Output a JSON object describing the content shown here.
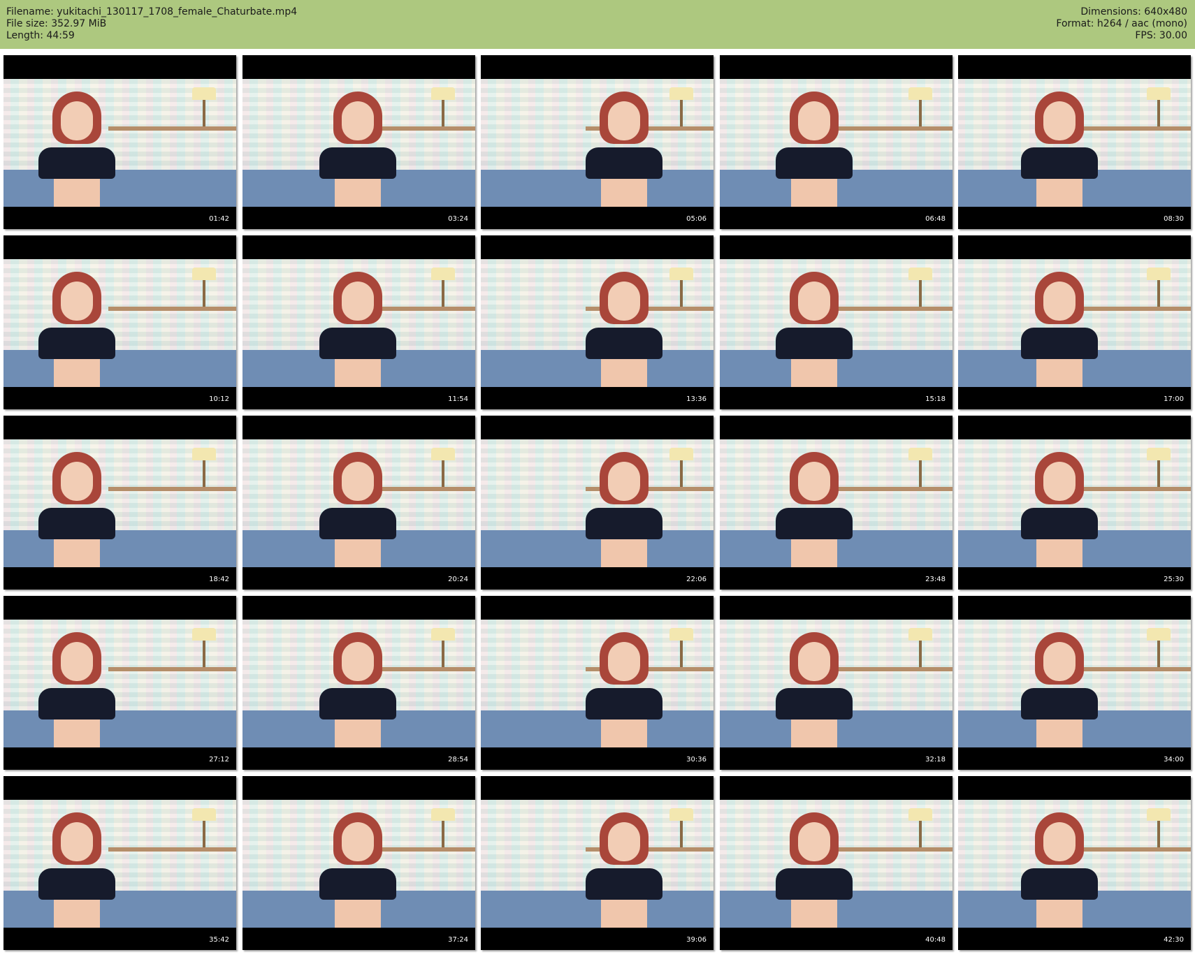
{
  "header": {
    "filename": "Filename: yukitachi_130117_1708_female_Chaturbate.mp4",
    "file_size": "File size: 352.97 MiB",
    "length": "Length: 44:59",
    "dimensions": "Dimensions: 640x480",
    "format": "Format: h264 / aac (mono)",
    "fps": "FPS: 30.00"
  },
  "colors": {
    "header_background": "#adc87f",
    "page_background": "#ffffff",
    "thumb_border": "#000000"
  },
  "thumbnails": [
    {
      "time": "01:42"
    },
    {
      "time": "03:24"
    },
    {
      "time": "05:06"
    },
    {
      "time": "06:48"
    },
    {
      "time": "08:30"
    },
    {
      "time": "10:12"
    },
    {
      "time": "11:54"
    },
    {
      "time": "13:36"
    },
    {
      "time": "15:18"
    },
    {
      "time": "17:00"
    },
    {
      "time": "18:42"
    },
    {
      "time": "20:24"
    },
    {
      "time": "22:06"
    },
    {
      "time": "23:48"
    },
    {
      "time": "25:30"
    },
    {
      "time": "27:12"
    },
    {
      "time": "28:54"
    },
    {
      "time": "30:36"
    },
    {
      "time": "32:18"
    },
    {
      "time": "34:00"
    },
    {
      "time": "35:42"
    },
    {
      "time": "37:24"
    },
    {
      "time": "39:06"
    },
    {
      "time": "40:48"
    },
    {
      "time": "42:30"
    }
  ]
}
